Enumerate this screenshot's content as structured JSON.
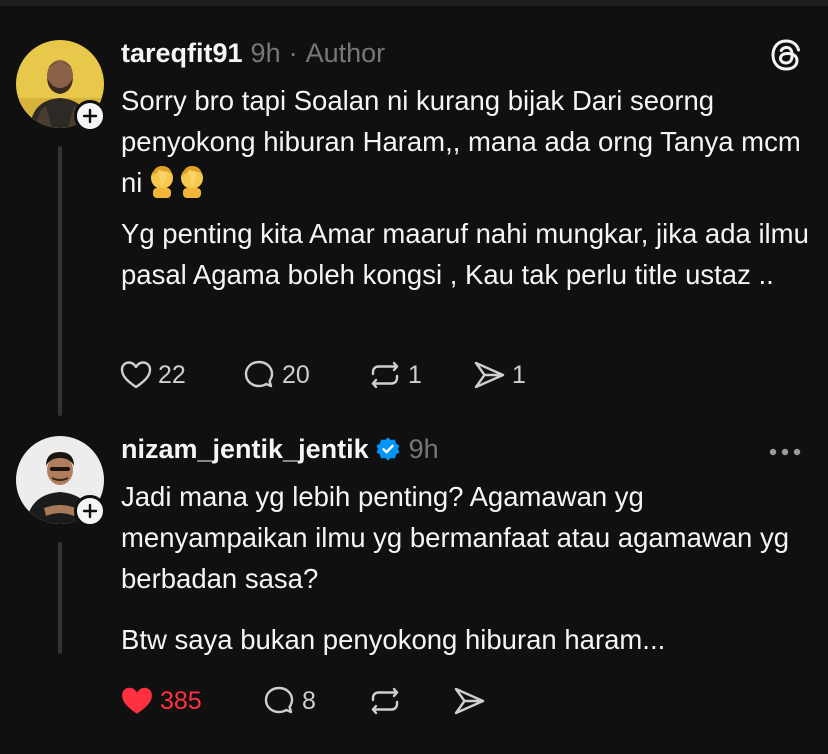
{
  "posts": [
    {
      "username": "tareqfit91",
      "time": "9h",
      "separator": "·",
      "badge": "Author",
      "paragraphs": [
        "Sorry bro tapi Soalan ni kurang bijak Dari seorng penyokong hiburan Haram,, mana ada orng Tanya mcm ni",
        "Yg penting kita Amar maaruf nahi mungkar, jika ada ilmu pasal Agama boleh kongsi , Kau tak perlu title ustaz .."
      ],
      "emoji": "🤦‍♂️🤦‍♂️",
      "likes": "22",
      "comments": "20",
      "reposts": "1",
      "shares": "1"
    },
    {
      "username": "nizam_jentik_jentik",
      "time": "9h",
      "paragraphs": [
        "Jadi mana yg lebih penting? Agamawan yg menyampaikan ilmu yg bermanfaat atau agamawan yg berbadan sasa?",
        "Btw saya bukan penyokong hiburan haram..."
      ],
      "likes": "385",
      "comments": "8"
    }
  ],
  "colors": {
    "like_active": "#ff3040",
    "verified": "#0095f6"
  }
}
